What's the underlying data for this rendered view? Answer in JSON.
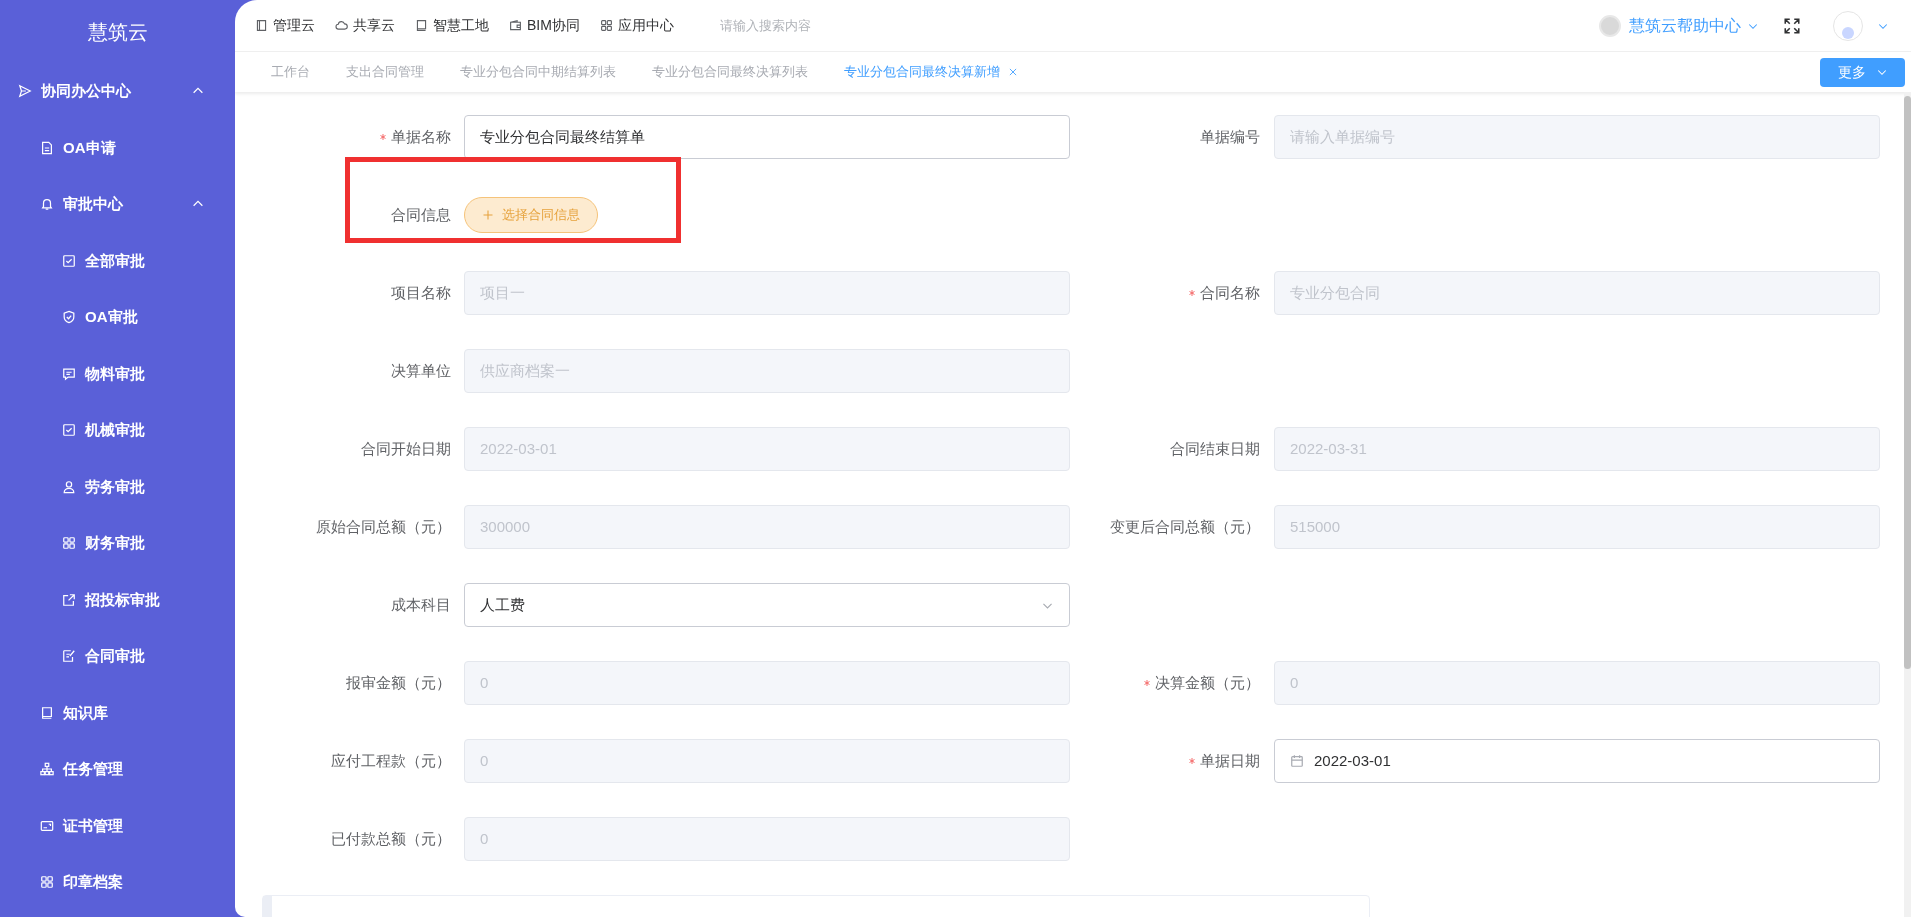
{
  "sidebar": {
    "logo": "慧筑云",
    "items": [
      {
        "label": "协同办公中心",
        "expanded": true,
        "children": [
          {
            "label": "OA申请"
          },
          {
            "label": "审批中心",
            "expanded": true,
            "children": [
              {
                "label": "全部审批"
              },
              {
                "label": "OA审批"
              },
              {
                "label": "物料审批"
              },
              {
                "label": "机械审批"
              },
              {
                "label": "劳务审批"
              },
              {
                "label": "财务审批"
              },
              {
                "label": "招投标审批"
              },
              {
                "label": "合同审批"
              }
            ]
          },
          {
            "label": "知识库"
          },
          {
            "label": "任务管理"
          },
          {
            "label": "证书管理"
          },
          {
            "label": "印章档案"
          }
        ]
      }
    ]
  },
  "top_nav": {
    "items": [
      "管理云",
      "共享云",
      "智慧工地",
      "BIM协同",
      "应用中心"
    ],
    "search": {
      "placeholder": "请输入搜索内容"
    },
    "help": "慧筑云帮助中心"
  },
  "tabs": [
    {
      "label": "工作台",
      "selected": false,
      "closable": false
    },
    {
      "label": "支出合同管理",
      "selected": false,
      "closable": false
    },
    {
      "label": "专业分包合同中期结算列表",
      "selected": false,
      "closable": false
    },
    {
      "label": "专业分包合同最终决算列表",
      "selected": false,
      "closable": false
    },
    {
      "label": "专业分包合同最终决算新增",
      "selected": true,
      "closable": true
    }
  ],
  "more_button": "更多",
  "form": {
    "rows": [
      {
        "fields": [
          {
            "kind": "input",
            "label": "单据名称",
            "required": true,
            "value": "专业分包合同最终结算单",
            "disabled": false
          },
          {
            "kind": "input",
            "label": "单据编号",
            "required": false,
            "placeholder": "请输入单据编号",
            "disabled": true
          }
        ]
      },
      {
        "highlighted": true,
        "fields": [
          {
            "kind": "button",
            "label": "合同信息",
            "required": false,
            "button": "选择合同信息"
          }
        ]
      },
      {
        "fields": [
          {
            "kind": "input",
            "label": "项目名称",
            "required": false,
            "value": "项目一",
            "disabled": true
          },
          {
            "kind": "input",
            "label": "合同名称",
            "required": true,
            "value": "专业分包合同",
            "disabled": true
          }
        ]
      },
      {
        "fields": [
          {
            "kind": "input",
            "label": "决算单位",
            "required": false,
            "value": "供应商档案一",
            "disabled": true
          }
        ]
      },
      {
        "fields": [
          {
            "kind": "input",
            "label": "合同开始日期",
            "required": false,
            "value": "2022-03-01",
            "disabled": true
          },
          {
            "kind": "input",
            "label": "合同结束日期",
            "required": false,
            "value": "2022-03-31",
            "disabled": true
          }
        ]
      },
      {
        "fields": [
          {
            "kind": "input",
            "label": "原始合同总额（元）",
            "required": false,
            "value": "300000",
            "disabled": true
          },
          {
            "kind": "input",
            "label": "变更后合同总额（元）",
            "required": false,
            "value": "515000",
            "disabled": true
          }
        ]
      },
      {
        "fields": [
          {
            "kind": "select",
            "label": "成本科目",
            "required": false,
            "value": "人工费",
            "disabled": false
          }
        ]
      },
      {
        "fields": [
          {
            "kind": "input",
            "label": "报审金额（元）",
            "required": false,
            "value": "0",
            "disabled": true
          },
          {
            "kind": "input",
            "label": "决算金额（元）",
            "required": true,
            "value": "0",
            "disabled": true
          }
        ]
      },
      {
        "fields": [
          {
            "kind": "input",
            "label": "应付工程款（元）",
            "required": false,
            "value": "0",
            "disabled": true
          },
          {
            "kind": "date",
            "label": "单据日期",
            "required": true,
            "value": "2022-03-01",
            "disabled": false
          }
        ]
      },
      {
        "fields": [
          {
            "kind": "input",
            "label": "已付款总额（元）",
            "required": false,
            "value": "0",
            "disabled": true
          }
        ]
      }
    ]
  }
}
